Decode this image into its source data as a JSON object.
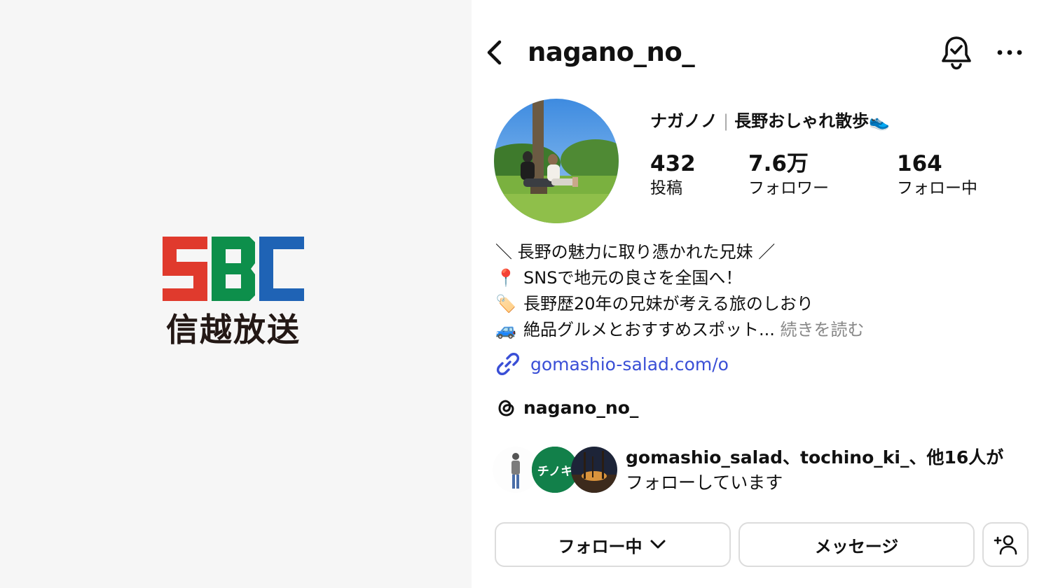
{
  "logo": {
    "initials": "SBC",
    "name": "信越放送",
    "colors": [
      "#e03a2d",
      "#0d8f4b",
      "#1f63b5"
    ]
  },
  "header": {
    "username": "nagano_no_"
  },
  "profile": {
    "display_name_jp": "ナガノノ",
    "display_name_tag": "長野おしゃれ散歩",
    "display_name_emoji": "👟",
    "stats": [
      {
        "value": "432",
        "label": "投稿"
      },
      {
        "value": "7.6万",
        "label": "フォロワー"
      },
      {
        "value": "164",
        "label": "フォロー中"
      }
    ]
  },
  "bio": {
    "line1": "＼ 長野の魅力に取り憑かれた兄妹 ／",
    "line2_emoji": "📍",
    "line2": "SNSで地元の良さを全国へ！",
    "line3_emoji": "🏷️",
    "line3": "長野歴20年の兄妹が考える旅のしおり",
    "line4_emoji": "🚙",
    "line4": "絶品グルメとおすすめスポット...",
    "more": "続きを読む"
  },
  "link": {
    "text": "gomashio-salad.com/o"
  },
  "threads": {
    "handle": "nagano_no_"
  },
  "mutual": {
    "line1": "gomashio_salad、tochino_ki_、他16人が",
    "line2": "フォローしています",
    "avatar2_text": "チノキ"
  },
  "buttons": {
    "following": "フォロー中",
    "message": "メッセージ"
  }
}
